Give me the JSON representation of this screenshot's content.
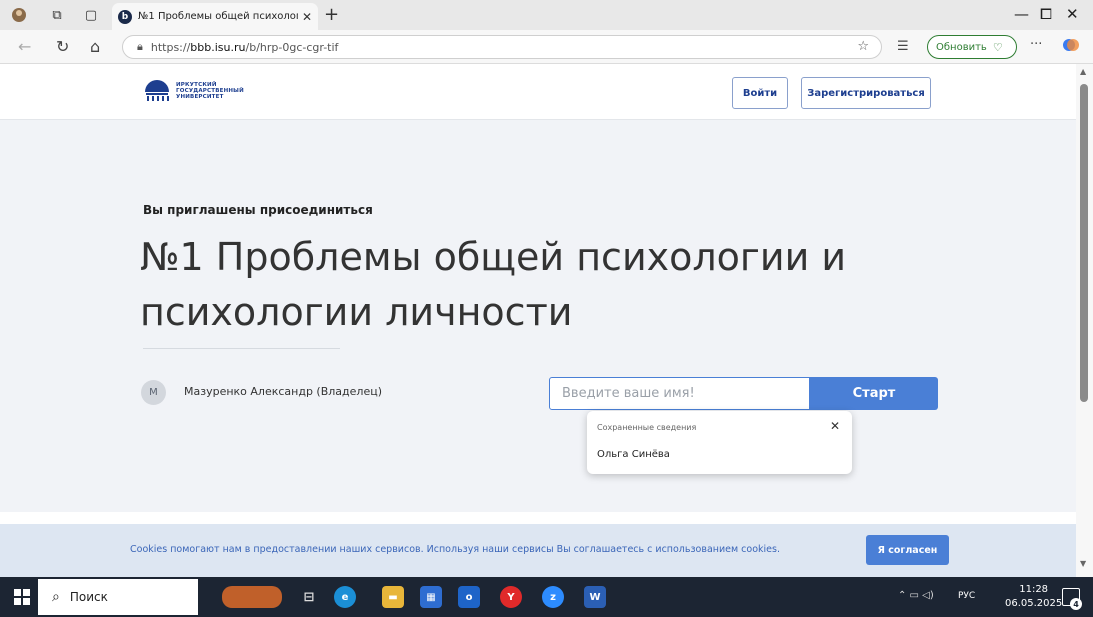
{
  "browser": {
    "tab_title": "№1 Проблемы общей психолог",
    "tab_favicon": "b",
    "url_prefix": "https://",
    "url_host": "bbb.isu.ru",
    "url_path": "/b/hrp-0gc-cgr-tif",
    "update_label": "Обновить"
  },
  "header": {
    "logo_line1": "ИРКУТСКИЙ",
    "logo_line2": "ГОСУДАРСТВЕННЫЙ",
    "logo_line3": "УНИВЕРСИТЕТ",
    "login_label": "Войти",
    "register_label": "Зарегистрироваться"
  },
  "main": {
    "invite_text": "Вы приглашены присоединиться",
    "room_title": "№1 Проблемы общей психологии и психологии личности",
    "owner_initial": "M",
    "owner_name": "Мазуренко Александр (Владелец)",
    "name_placeholder": "Введите ваше имя!",
    "start_label": "Старт"
  },
  "autofill": {
    "heading": "Сохраненные сведения",
    "close_glyph": "✕",
    "item": "Ольга Синёва"
  },
  "cookie": {
    "text": "Cookies помогают нам в предоставлении наших сервисов. Используя наши сервисы Вы соглашаетесь с использованием cookies.",
    "accept_label": "Я согласен"
  },
  "taskbar": {
    "search_label": "Поиск",
    "lang": "РУС",
    "time": "11:28",
    "date": "06.05.2025",
    "notification_count": "4"
  },
  "colors": {
    "accent": "#4a7fd6",
    "brand": "#1d3e8f",
    "cookie_bg": "#dde6f2",
    "taskbar": "#1c2533"
  }
}
